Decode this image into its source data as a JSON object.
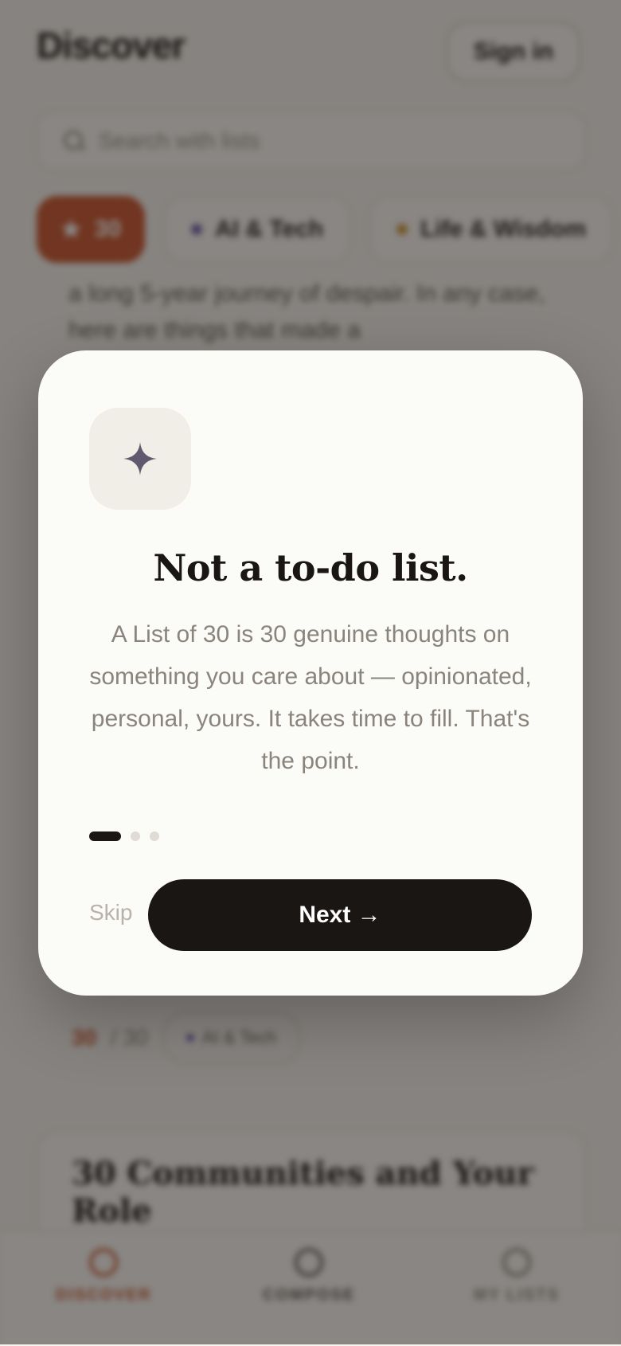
{
  "header": {
    "title": "Discover",
    "signin_label": "Sign in"
  },
  "search": {
    "placeholder": "Search with lists"
  },
  "chips": [
    {
      "label": "30",
      "color": "#c8552e"
    },
    {
      "label": "AI & Tech",
      "color": "#6b63a8"
    },
    {
      "label": "Life & Wisdom",
      "color": "#c9973a"
    }
  ],
  "card": {
    "excerpt": "a long 5-year journey of despair. In any case, here are things that made a",
    "meta_count": "30",
    "meta_of": "/ 30",
    "meta_tag": "AI & Tech"
  },
  "card2": {
    "title": "30 Communities and Your Role"
  },
  "tabbar": {
    "discover": "DISCOVER",
    "compose": "COMPOSE",
    "mylists": "MY LISTS"
  },
  "modal": {
    "icon": "sparkle-icon",
    "title": "Not a to-do list.",
    "body": "A List of 30 is 30 genuine thoughts on something you care about — opinionated, personal, yours. It takes time to fill. That's the point.",
    "skip_label": "Skip",
    "next_label": "Next →",
    "pagination": {
      "current": 1,
      "total": 3
    }
  },
  "colors": {
    "accent": "#c8552e",
    "dark": "#1a1613",
    "sparkle": "#5f5a6e"
  }
}
